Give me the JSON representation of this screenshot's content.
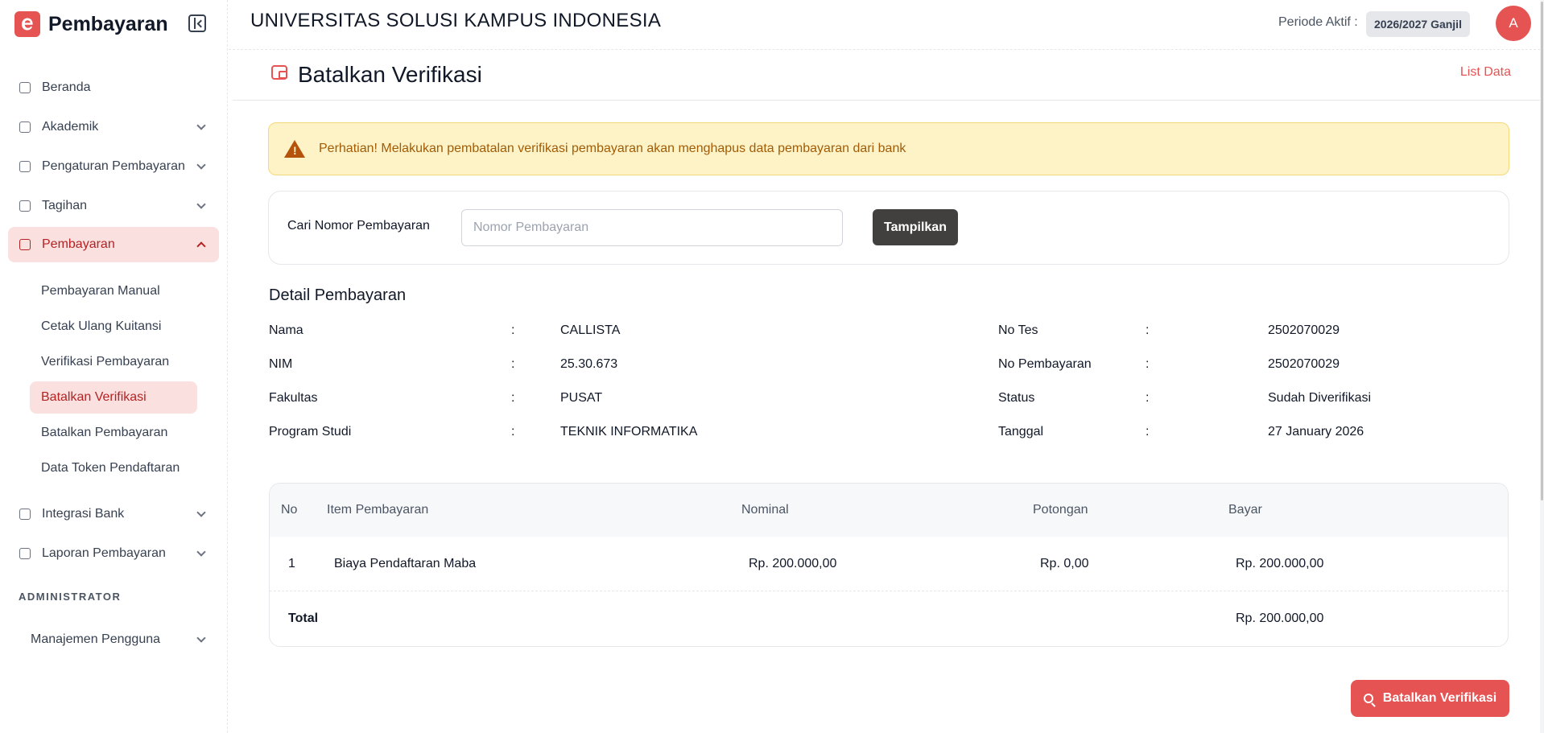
{
  "brand": {
    "name": "Pembayaran",
    "logo_letter": "e"
  },
  "sidebar": {
    "items": [
      {
        "label": "Beranda",
        "icon": "home-icon",
        "has_chevron": false
      },
      {
        "label": "Akademik",
        "icon": "graduation-cap-icon",
        "has_chevron": true
      },
      {
        "label": "Pengaturan Pembayaran",
        "icon": "settings-coin-icon",
        "has_chevron": true
      },
      {
        "label": "Tagihan",
        "icon": "clipboard-icon",
        "has_chevron": true
      },
      {
        "label": "Pembayaran",
        "icon": "wallet-icon",
        "has_chevron": true,
        "expanded": true
      }
    ],
    "sub_items": [
      {
        "label": "Pembayaran Manual"
      },
      {
        "label": "Cetak Ulang Kuitansi"
      },
      {
        "label": "Verifikasi Pembayaran"
      },
      {
        "label": "Batalkan Verifikasi",
        "active": true
      },
      {
        "label": "Batalkan Pembayaran"
      },
      {
        "label": "Data Token Pendaftaran"
      }
    ],
    "items_after": [
      {
        "label": "Integrasi Bank",
        "icon": "bank-icon",
        "has_chevron": true
      },
      {
        "label": "Laporan Pembayaran",
        "icon": "report-icon",
        "has_chevron": true
      }
    ],
    "section_title": "ADMINISTRATOR",
    "admin_items": [
      {
        "label": "Manajemen Pengguna",
        "has_chevron": true
      }
    ]
  },
  "header": {
    "university": "UNIVERSITAS SOLUSI KAMPUS INDONESIA",
    "periode_label": "Periode Aktif :",
    "periode_value": "2026/2027 Ganjil",
    "avatar_initial": "A"
  },
  "page": {
    "title": "Batalkan Verifikasi",
    "list_link": "List Data"
  },
  "alert": {
    "text": "Perhatian! Melakukan pembatalan verifikasi pembayaran akan menghapus data pembayaran dari bank"
  },
  "search": {
    "label": "Cari Nomor Pembayaran",
    "placeholder": "Nomor Pembayaran",
    "value": "",
    "button": "Tampilkan"
  },
  "detail": {
    "title": "Detail Pembayaran",
    "separator": ":",
    "left": [
      {
        "label": "Nama",
        "value": "CALLISTA"
      },
      {
        "label": "NIM",
        "value": "25.30.673"
      },
      {
        "label": "Fakultas",
        "value": "PUSAT"
      },
      {
        "label": "Program Studi",
        "value": "TEKNIK INFORMATIKA"
      }
    ],
    "right": [
      {
        "label": "No Tes",
        "value": "2502070029"
      },
      {
        "label": "No Pembayaran",
        "value": "2502070029"
      },
      {
        "label": "Status",
        "value": "Sudah Diverifikasi"
      },
      {
        "label": "Tanggal",
        "value": "27 January 2026"
      }
    ]
  },
  "table": {
    "headers": [
      "No",
      "Item Pembayaran",
      "Nominal",
      "Potongan",
      "Bayar"
    ],
    "rows": [
      {
        "no": "1",
        "item": "Biaya Pendaftaran Maba",
        "nominal": "Rp. 200.000,00",
        "potongan": "Rp. 0,00",
        "bayar": "Rp. 200.000,00"
      }
    ],
    "total_label": "Total",
    "total_value": "Rp. 200.000,00"
  },
  "actions": {
    "cancel_button": "Batalkan Verifikasi"
  },
  "colors": {
    "accent": "#e55353",
    "active_bg": "#fbe0e0",
    "alert_bg": "#fef3c7",
    "alert_text": "#a15c07",
    "dark_button": "#423f3f"
  }
}
